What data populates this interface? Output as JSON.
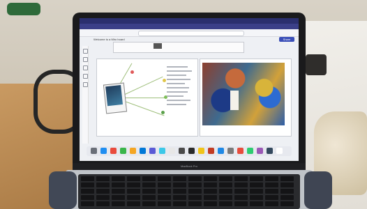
{
  "screen": {
    "share_label": "Share",
    "document_title": "Welcome to a Miro board",
    "brand_label": "MacBook Pro"
  },
  "dock": {
    "icon_colors": [
      "#6a6f78",
      "#1f8ef1",
      "#e94b3c",
      "#39b54a",
      "#f5a623",
      "#0078d7",
      "#5a5ad6",
      "#3cc8e8",
      "#e7e7e7",
      "#4a4a4a",
      "#2a2a2a",
      "#f0c419",
      "#c23b22",
      "#1e88e5",
      "#7a7a7a",
      "#e74c3c",
      "#2ecc71",
      "#9b59b6",
      "#34495e",
      "#ffffff"
    ]
  },
  "colors": {
    "browser_bar": "#2b2f6e",
    "accent_button": "#3b4fb8"
  }
}
